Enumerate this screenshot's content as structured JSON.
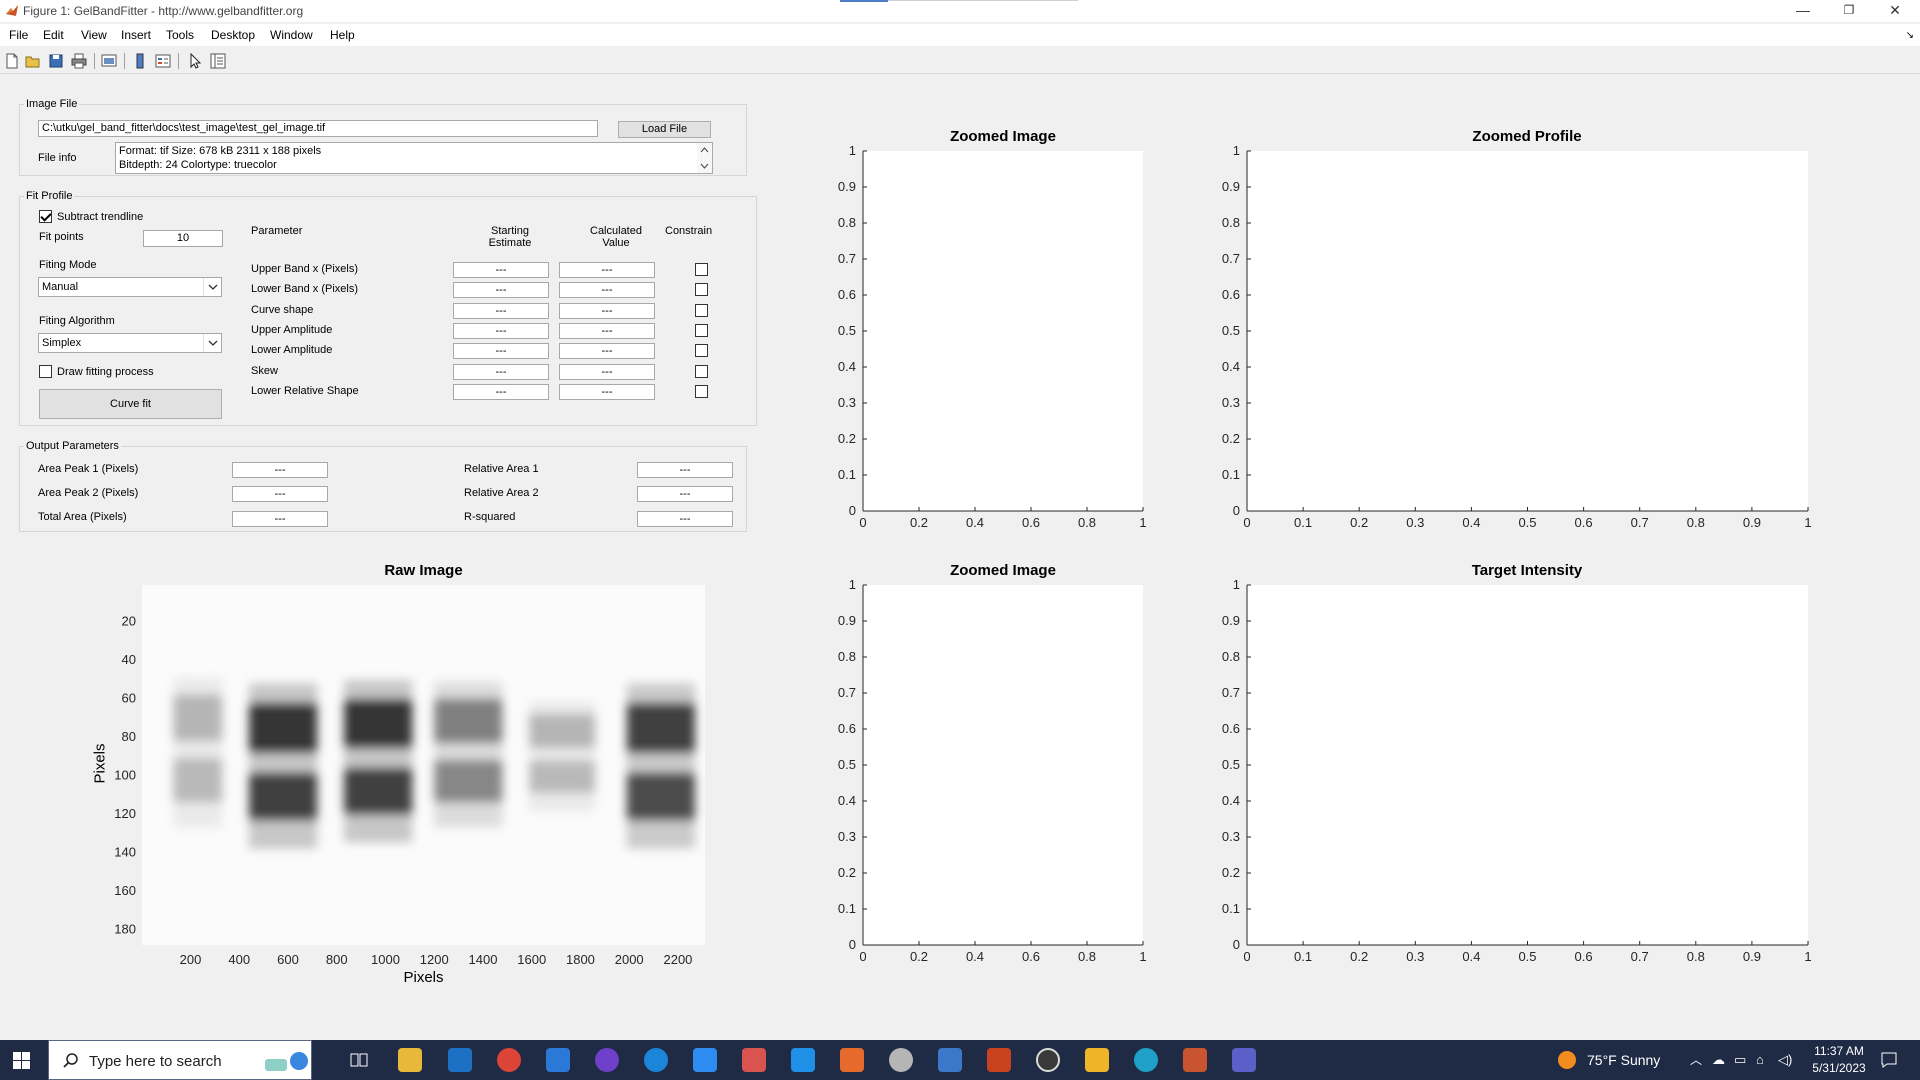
{
  "window": {
    "title": "Figure 1: GelBandFitter - http://www.gelbandfitter.org",
    "minimize": "—",
    "maximize": "❐",
    "close": "✕"
  },
  "menu": {
    "items": [
      "File",
      "Edit",
      "View",
      "Insert",
      "Tools",
      "Desktop",
      "Window",
      "Help"
    ]
  },
  "image_file": {
    "title": "Image File",
    "path": "C:\\utku\\gel_band_fitter\\docs\\test_image\\test_gel_image.tif",
    "load_button": "Load File",
    "info_label": "File info",
    "info_line1": "Format: tif    Size: 678 kB     2311 x 188 pixels",
    "info_line2": "Bitdepth: 24    Colortype: truecolor"
  },
  "fit_profile": {
    "title": "Fit Profile",
    "subtract_trendline": "Subtract trendline",
    "subtract_checked": true,
    "fit_points_label": "Fit points",
    "fit_points_value": "10",
    "fitting_mode_label": "Fiting Mode",
    "fitting_mode_value": "Manual",
    "fitting_algorithm_label": "Fiting Algorithm",
    "fitting_algorithm_value": "Simplex",
    "draw_fitting_process": "Draw fitting process",
    "draw_checked": false,
    "curve_fit_button": "Curve fit",
    "col_parameter": "Parameter",
    "col_starting_1": "Starting",
    "col_starting_2": "Estimate",
    "col_calculated_1": "Calculated",
    "col_calculated_2": "Value",
    "col_constrain": "Constrain",
    "params": [
      {
        "name": "Upper Band x (Pixels)",
        "start": "---",
        "calc": "---"
      },
      {
        "name": "Lower Band x (Pixels)",
        "start": "---",
        "calc": "---"
      },
      {
        "name": "Curve shape",
        "start": "---",
        "calc": "---"
      },
      {
        "name": "Upper Amplitude",
        "start": "---",
        "calc": "---"
      },
      {
        "name": "Lower Amplitude",
        "start": "---",
        "calc": "---"
      },
      {
        "name": "Skew",
        "start": "---",
        "calc": "---"
      },
      {
        "name": "Lower Relative Shape",
        "start": "---",
        "calc": "---"
      }
    ]
  },
  "output": {
    "title": "Output Parameters",
    "area_peak1_label": "Area Peak 1 (Pixels)",
    "area_peak1_value": "---",
    "area_peak2_label": "Area Peak 2  (Pixels)",
    "area_peak2_value": "---",
    "total_area_label": "Total Area  (Pixels)",
    "total_area_value": "---",
    "rel_area1_label": "Relative Area 1",
    "rel_area1_value": "---",
    "rel_area2_label": "Relative Area 2",
    "rel_area2_value": "---",
    "rsquared_label": "R-squared",
    "rsquared_value": "---"
  },
  "plots": {
    "zoomed_image_top": {
      "title": "Zoomed Image",
      "xticks": [
        "0",
        "0.2",
        "0.4",
        "0.6",
        "0.8",
        "1"
      ],
      "yticks": [
        "0",
        "0.1",
        "0.2",
        "0.3",
        "0.4",
        "0.5",
        "0.6",
        "0.7",
        "0.8",
        "0.9",
        "1"
      ]
    },
    "zoomed_profile": {
      "title": "Zoomed Profile",
      "xticks": [
        "0",
        "0.1",
        "0.2",
        "0.3",
        "0.4",
        "0.5",
        "0.6",
        "0.7",
        "0.8",
        "0.9",
        "1"
      ],
      "yticks": [
        "0",
        "0.1",
        "0.2",
        "0.3",
        "0.4",
        "0.5",
        "0.6",
        "0.7",
        "0.8",
        "0.9",
        "1"
      ]
    },
    "zoomed_image_bottom": {
      "title": "Zoomed Image",
      "xticks": [
        "0",
        "0.2",
        "0.4",
        "0.6",
        "0.8",
        "1"
      ],
      "yticks": [
        "0",
        "0.1",
        "0.2",
        "0.3",
        "0.4",
        "0.5",
        "0.6",
        "0.7",
        "0.8",
        "0.9",
        "1"
      ]
    },
    "target_intensity": {
      "title": "Target Intensity",
      "xticks": [
        "0",
        "0.1",
        "0.2",
        "0.3",
        "0.4",
        "0.5",
        "0.6",
        "0.7",
        "0.8",
        "0.9",
        "1"
      ],
      "yticks": [
        "0",
        "0.1",
        "0.2",
        "0.3",
        "0.4",
        "0.5",
        "0.6",
        "0.7",
        "0.8",
        "0.9",
        "1"
      ]
    },
    "raw_image": {
      "title": "Raw Image",
      "xlabel": "Pixels",
      "ylabel": "Pixels",
      "xticks": [
        "200",
        "400",
        "600",
        "800",
        "1000",
        "1200",
        "1400",
        "1600",
        "1800",
        "2000",
        "2200"
      ],
      "yticks": [
        "20",
        "40",
        "60",
        "80",
        "100",
        "120",
        "140",
        "160",
        "180"
      ],
      "xlim": [
        1,
        2311
      ],
      "ylim": [
        1,
        188
      ]
    }
  },
  "gel_lanes": [
    {
      "x_start": 130,
      "x_end": 330,
      "low": 58,
      "high": 118,
      "darkness": 0.35
    },
    {
      "x_start": 440,
      "x_end": 720,
      "low": 62,
      "high": 128,
      "darkness": 0.95
    },
    {
      "x_start": 830,
      "x_end": 1110,
      "low": 60,
      "high": 125,
      "darkness": 0.95
    },
    {
      "x_start": 1200,
      "x_end": 1480,
      "low": 60,
      "high": 118,
      "darkness": 0.6
    },
    {
      "x_start": 1590,
      "x_end": 1860,
      "low": 68,
      "high": 112,
      "darkness": 0.35
    },
    {
      "x_start": 1990,
      "x_end": 2270,
      "low": 62,
      "high": 128,
      "darkness": 0.9
    }
  ],
  "taskbar": {
    "search_placeholder": "Type here to search",
    "weather": "75°F  Sunny",
    "time": "11:37 AM",
    "date": "5/31/2023"
  },
  "colors": {
    "accent": "#4d7cc9",
    "taskbar_bg": "#1f2a44",
    "plot_bg": "#ffffff"
  }
}
